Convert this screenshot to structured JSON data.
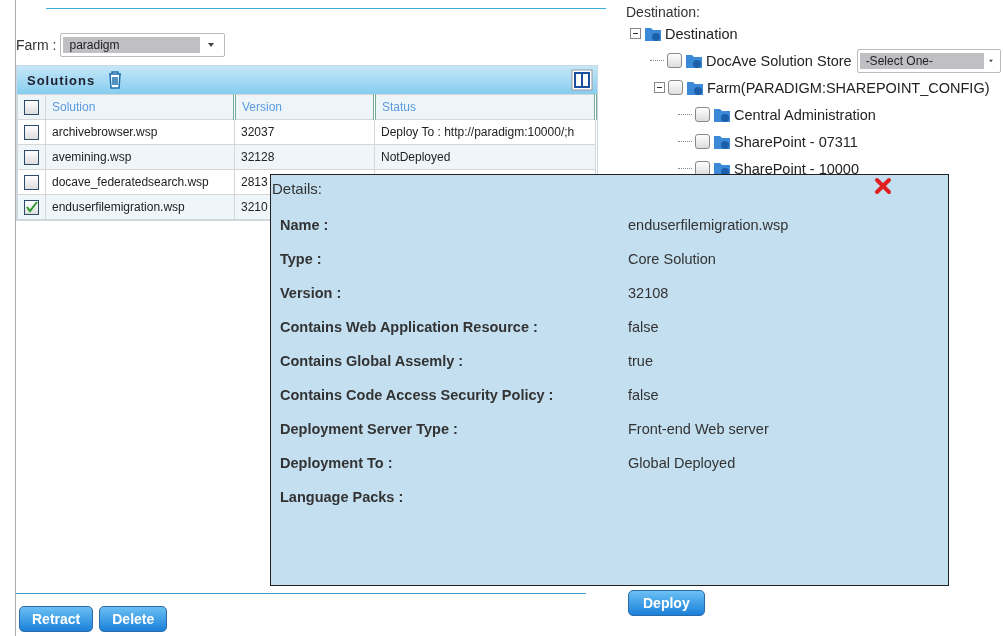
{
  "farm": {
    "label": "Farm :",
    "value": "paradigm"
  },
  "solutions": {
    "title": "Solutions",
    "columns": [
      "Solution",
      "Version",
      "Status"
    ],
    "all_checked": false,
    "rows": [
      {
        "solution": "archivebrowser.wsp",
        "version": "32037",
        "status": "Deploy To : http://paradigm:10000/;h",
        "checked": false
      },
      {
        "solution": "avemining.wsp",
        "version": "32128",
        "status": "NotDeployed",
        "checked": false
      },
      {
        "solution": "docave_federatedsearch.wsp",
        "version": "2813",
        "checked": false
      },
      {
        "solution": "enduserfilemigration.wsp",
        "version": "3210",
        "checked": true
      }
    ]
  },
  "buttons": [
    "Retract",
    "Delete"
  ],
  "destination": {
    "label": "Destination:",
    "tree": {
      "name": "Destination",
      "expanded": true,
      "children": [
        {
          "name": "DocAve Solution Store",
          "checked": false,
          "select": "-Select One-"
        },
        {
          "name": "Farm(PARADIGM:SHAREPOINT_CONFIG)",
          "checked": false,
          "expanded": true,
          "children": [
            {
              "name": "Central Administration",
              "checked": false
            },
            {
              "name": "SharePoint - 07311",
              "checked": false
            },
            {
              "name": "SharePoint - 10000",
              "checked": false
            }
          ]
        }
      ]
    }
  },
  "deploy_button": "Deploy",
  "details": {
    "title": "Details:",
    "fields": [
      {
        "label": "Name :",
        "value": "enduserfilemigration.wsp"
      },
      {
        "label": "Type :",
        "value": "Core Solution"
      },
      {
        "label": "Version :",
        "value": "32108"
      },
      {
        "label": "Contains Web Application Resource :",
        "value": "false"
      },
      {
        "label": "Contains Global Assemly :",
        "value": "true"
      },
      {
        "label": "Contains Code Access Security Policy :",
        "value": "false"
      },
      {
        "label": "Deployment Server Type :",
        "value": "Front-end Web server"
      },
      {
        "label": "Deployment To :",
        "value": "Global Deployed"
      },
      {
        "label": "Language Packs :"
      }
    ]
  }
}
